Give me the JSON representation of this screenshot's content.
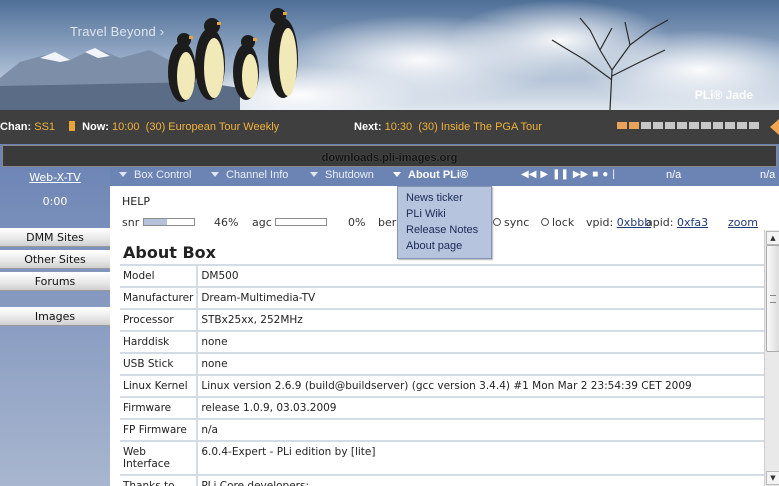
{
  "banner": {
    "brand_a": "Travel Beyond",
    "brand_arrow": "›",
    "product": "PLi® Jade"
  },
  "epg": {
    "chan_label": "Chan:",
    "chan_value": "SS1",
    "now_label": "Now:",
    "now_time": "10:00",
    "now_title": "(30) European Tour Weekly",
    "next_label": "Next:",
    "next_time": "10:30",
    "next_title": "(30) Inside The PGA Tour",
    "volume_level": 2,
    "volume_steps": 12
  },
  "url": "downloads.pli-images.org",
  "sidebar": {
    "title": "Web-X-TV",
    "clock": "0:00",
    "buttons": [
      "DMM Sites",
      "Other Sites",
      "Forums",
      "Images"
    ]
  },
  "nav": {
    "items": [
      "Box Control",
      "Channel Info",
      "Shutdown",
      "About PLi®"
    ],
    "controls": [
      "◀◀",
      "▶",
      "❚❚",
      "▶▶",
      "■",
      "●",
      "|"
    ],
    "na1": "n/a",
    "na2": "n/a"
  },
  "dropdown": [
    "News ticker",
    "PLi Wiki",
    "Release Notes",
    "About page"
  ],
  "status": {
    "help": "HELP",
    "snr_label": "snr",
    "snr_value": "46%",
    "snr_level": 0.46,
    "agc_label": "agc",
    "agc_value": "0%",
    "agc_level": 0,
    "ber_label": "ber",
    "ber_value": "0",
    "sync_label": "sync",
    "lock_label": "lock",
    "vpid_label": "vpid:",
    "vpid_value": "0xbbb",
    "apid_label": "apid:",
    "apid_value": "0xfa3",
    "zoom": "zoom"
  },
  "about": {
    "title": "About Box",
    "rows": [
      {
        "k": "Model",
        "v": "DM500"
      },
      {
        "k": "Manufacturer",
        "v": "Dream-Multimedia-TV"
      },
      {
        "k": "Processor",
        "v": "STBx25xx, 252MHz"
      },
      {
        "k": "Harddisk",
        "v": "none"
      },
      {
        "k": "USB Stick",
        "v": "none"
      },
      {
        "k": "Linux Kernel",
        "v": "Linux version 2.6.9 (build@buildserver) (gcc version 3.4.4) #1 Mon Mar 2 23:54:39 CET 2009"
      },
      {
        "k": "Firmware",
        "v": "release 1.0.9, 03.03.2009"
      },
      {
        "k": "FP Firmware",
        "v": "n/a"
      },
      {
        "k": "Web Interface",
        "v": "6.0.4-Expert - PLi edition by [lite]"
      },
      {
        "k": "Thanks to",
        "v": "PLi Core developers:"
      }
    ]
  }
}
